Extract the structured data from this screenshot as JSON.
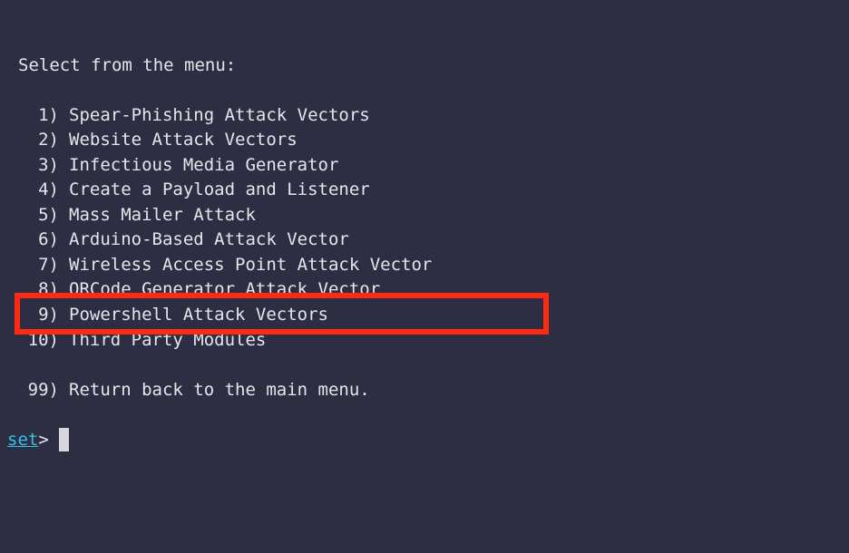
{
  "terminal": {
    "header": "Select from the menu:",
    "menu_items": [
      {
        "number": "1)",
        "label": "Spear-Phishing Attack Vectors"
      },
      {
        "number": "2)",
        "label": "Website Attack Vectors"
      },
      {
        "number": "3)",
        "label": "Infectious Media Generator"
      },
      {
        "number": "4)",
        "label": "Create a Payload and Listener"
      },
      {
        "number": "5)",
        "label": "Mass Mailer Attack"
      },
      {
        "number": "6)",
        "label": "Arduino-Based Attack Vector"
      },
      {
        "number": "7)",
        "label": "Wireless Access Point Attack Vector"
      },
      {
        "number": "8)",
        "label": "QRCode Generator Attack Vector"
      },
      {
        "number": "9)",
        "label": "Powershell Attack Vectors"
      },
      {
        "number": "10)",
        "label": "Third Party Modules"
      }
    ],
    "return_item": {
      "number": "99)",
      "label": "Return back to the main menu."
    },
    "prompt": {
      "name": "set",
      "symbol": ">"
    }
  },
  "colors": {
    "background": "#2d2d43",
    "text": "#e6e6ea",
    "prompt": "#33c3ea",
    "highlight": "#ff2a10"
  },
  "highlighted_item": "9)"
}
